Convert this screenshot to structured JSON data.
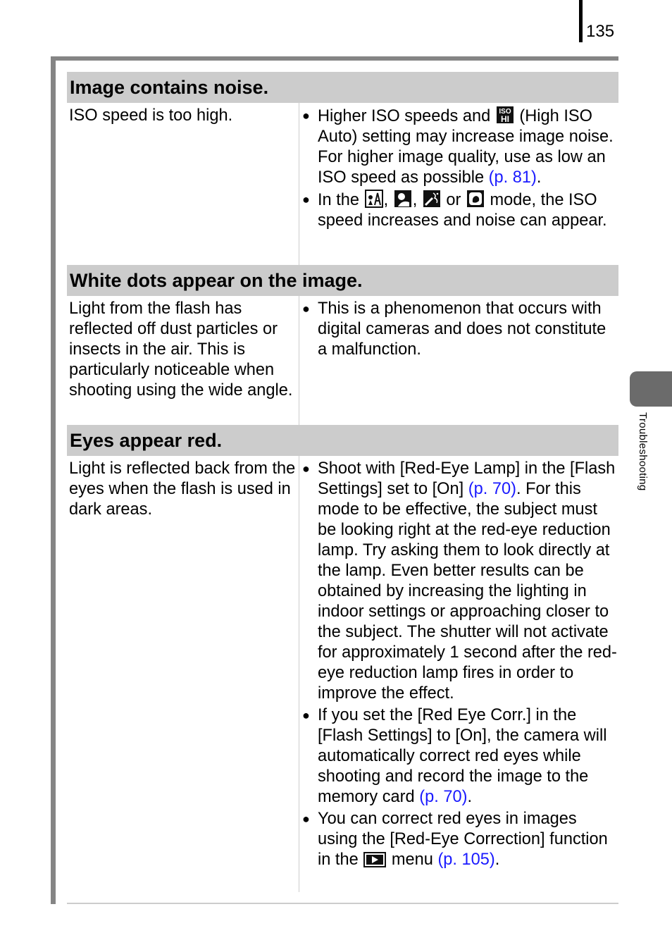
{
  "header": {
    "page_number": "135"
  },
  "side_tab": {
    "label": "Troubleshooting"
  },
  "sections": [
    {
      "title": "Image contains noise.",
      "cause": "ISO speed is too high.",
      "solutions": [
        {
          "pre": "Higher ISO speeds and",
          "icon": "iso-hi-icon",
          "post": "(High ISO Auto) setting may increase image noise. For higher image quality, use as low an ISO speed as possible",
          "link": "(p. 81)",
          "end": "."
        },
        {
          "pre": "In the",
          "icons": [
            "night-snapshot-icon",
            "kids-pets-icon",
            "indoor-party-icon",
            "fireworks-icon"
          ],
          "mid": "mode, the ISO speed increases and noise can appear."
        }
      ]
    },
    {
      "title": "White dots appear on the image.",
      "cause": "Light from the flash has reflected off dust particles or insects in the air. This is particularly noticeable when shooting using the wide angle.",
      "solutions": [
        {
          "text": "This is a phenomenon that occurs with digital cameras and does not constitute a malfunction."
        }
      ]
    },
    {
      "title": "Eyes appear red.",
      "cause": "Light is reflected back from the eyes when the flash is used in dark areas.",
      "solutions": [
        {
          "pre": "Shoot with [Red-Eye Lamp] in the [Flash Settings] set to [On]",
          "link": "(p. 70)",
          "post": ". For this mode to be effective, the subject must be looking right at the red-eye reduction lamp. Try asking them to look directly at the lamp. Even better results can be obtained by increasing the lighting in indoor settings or approaching closer to the subject. The shutter will not activate for approximately 1 second after the red-eye reduction lamp fires in order to improve the effect."
        },
        {
          "pre": "If you set the [Red Eye Corr.] in the [Flash Settings] to [On], the camera will automatically correct red eyes while shooting and record the image to the memory card",
          "link": "(p. 70)",
          "post": "."
        },
        {
          "pre": "You can correct red eyes in images using the [Red-Eye Correction] function in the",
          "icon": "playback-icon",
          "mid": "menu",
          "link": "(p. 105)",
          "post": "."
        }
      ]
    }
  ],
  "colors": {
    "link": "#1a1aff",
    "header_bg": "#cccccc",
    "frame": "#858585",
    "tab": "#6b6b6b"
  }
}
